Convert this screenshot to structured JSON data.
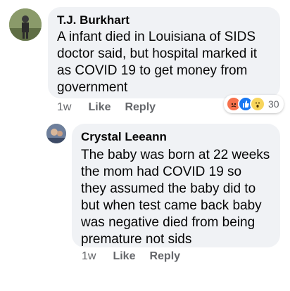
{
  "comments": [
    {
      "author": "T.J. Burkhart",
      "text": "A infant died in Louisiana of SIDS doctor said, but hospital marked it as COVID 19 to get money from government",
      "time": "1w",
      "like_label": "Like",
      "reply_label": "Reply",
      "reactions": {
        "icons": [
          "angry-icon",
          "like-icon",
          "wow-icon"
        ],
        "count": "30"
      }
    },
    {
      "author": "Crystal Leeann",
      "text": "The baby was born at 22 weeks the mom had COVID 19 so they assumed the baby did to but when test came back baby was negative died from being premature not sids",
      "time": "1w",
      "like_label": "Like",
      "reply_label": "Reply"
    }
  ],
  "colors": {
    "bubble": "#f0f2f5",
    "meta": "#65676b",
    "like_blue": "#1877f2",
    "angry_orange": "#f7714c",
    "wow_yellow": "#f7d55c"
  }
}
